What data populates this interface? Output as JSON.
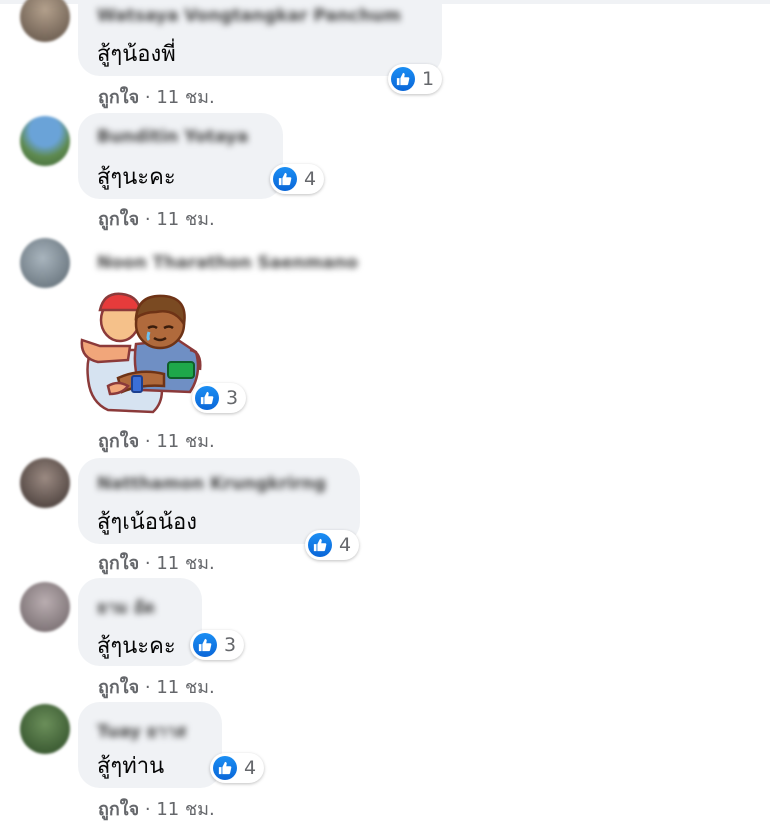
{
  "comments": [
    {
      "author": "Watsaya Vongtangkar Panchum",
      "text": "สู้ๆน้องพี่",
      "reactions": "1",
      "like": "ถูกใจ",
      "sep": " · ",
      "time": "11 ชม.",
      "avatar_color": "#7b6a5c"
    },
    {
      "author": "Bunditin Yotaya",
      "text": "สู้ๆนะคะ",
      "reactions": "4",
      "like": "ถูกใจ",
      "sep": " · ",
      "time": "11 ชม.",
      "avatar_color": "#5b8a55"
    },
    {
      "author": "Noon Tharathon Saenmano",
      "sticker": "hug-sticker",
      "reactions": "3",
      "like": "ถูกใจ",
      "sep": " · ",
      "time": "11 ชม.",
      "avatar_color": "#7c8a95"
    },
    {
      "author": "Natthamon Krungkrirng",
      "text": "สู้ๆเน้อน้อง",
      "reactions": "4",
      "like": "ถูกใจ",
      "sep": " · ",
      "time": "11 ชม.",
      "avatar_color": "#5d5450"
    },
    {
      "author": "ยาม อัด",
      "text": "สู้ๆนะคะ",
      "reactions": "3",
      "like": "ถูกใจ",
      "sep": " · ",
      "time": "11 ชม.",
      "avatar_color": "#9a8f92"
    },
    {
      "author": "Tuay ยาาส",
      "text": "สู้ๆท่าน",
      "reactions": "4",
      "like": "ถูกใจ",
      "sep": " · ",
      "time": "11 ชม.",
      "avatar_color": "#3f6b3a"
    }
  ],
  "colors": {
    "like_blue": "#1877f2",
    "bubble": "#f0f2f5",
    "meta_text": "#65676b"
  }
}
